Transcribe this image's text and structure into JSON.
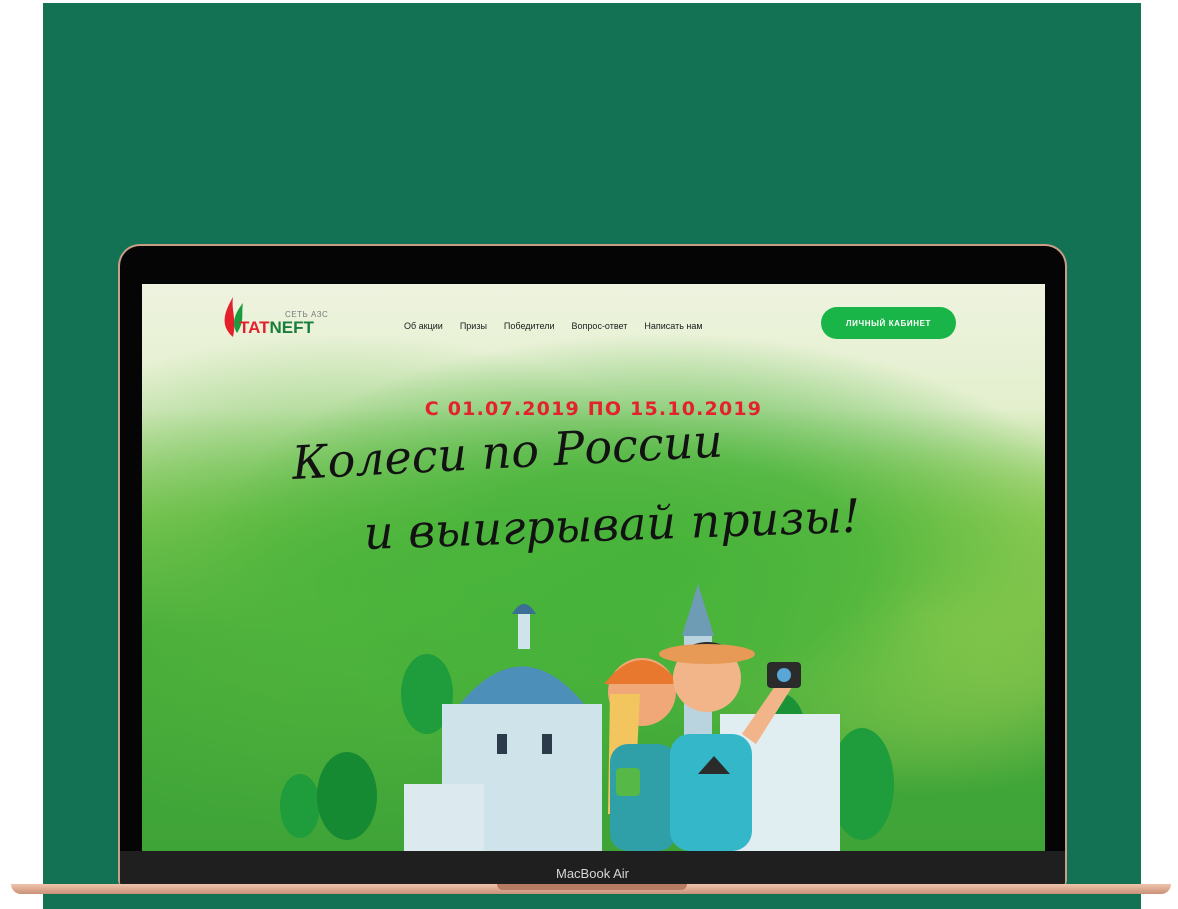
{
  "device": {
    "model_label": "MacBook Air"
  },
  "site": {
    "logo": {
      "caption": "СЕТЬ АЗС",
      "word_part1": "TAT",
      "word_part2": "NEFT"
    },
    "nav": [
      "Об акции",
      "Призы",
      "Победители",
      "Вопрос-ответ",
      "Написать нам"
    ],
    "cabinet_button": "ЛИЧНЫЙ КАБИНЕТ",
    "dates": "С 01.07.2019 ПО 15.10.2019",
    "headline_line1": "Колеси по России",
    "headline_line2": "и выигрывай призы!"
  },
  "colors": {
    "background": "#137154",
    "accent_red": "#e3222c",
    "button_green": "#1ab548"
  },
  "icons": [
    "tatneft-flame-logo",
    "camera-icon"
  ]
}
